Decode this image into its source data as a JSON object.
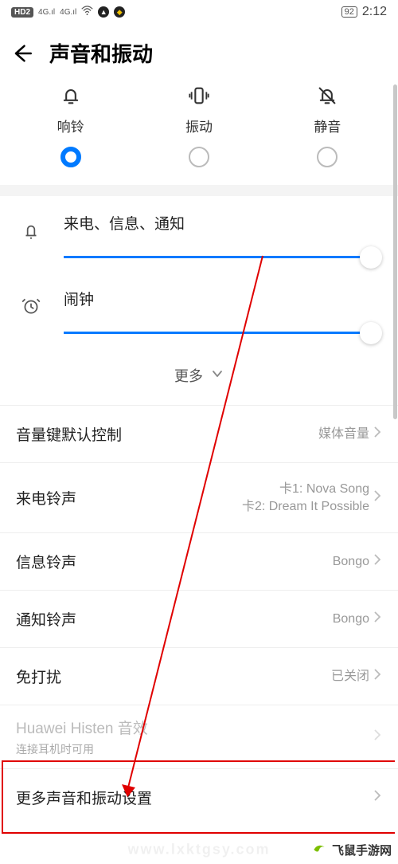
{
  "status": {
    "hd_badge": "HD2",
    "sig_a": "4G",
    "sig_b": "4G",
    "battery": "92",
    "clock": "2:12"
  },
  "header": {
    "title": "声音和振动"
  },
  "modes": [
    {
      "label": "响铃",
      "selected": true
    },
    {
      "label": "振动",
      "selected": false
    },
    {
      "label": "静音",
      "selected": false
    }
  ],
  "volumes": {
    "notify": {
      "label": "来电、信息、通知",
      "percent": 100
    },
    "alarm": {
      "label": "闹钟",
      "percent": 100
    }
  },
  "more_label": "更多",
  "settings": [
    {
      "label": "音量键默认控制",
      "value": "媒体音量"
    },
    {
      "label": "来电铃声",
      "value": "卡1: Nova Song\n卡2: Dream It Possible"
    },
    {
      "label": "信息铃声",
      "value": "Bongo"
    },
    {
      "label": "通知铃声",
      "value": "Bongo"
    },
    {
      "label": "免打扰",
      "value": "已关闭"
    },
    {
      "label": "Huawei Histen 音效",
      "sub": "连接耳机时可用",
      "disabled": true
    },
    {
      "label": "更多声音和振动设置"
    }
  ],
  "watermark": {
    "text": "飞鼠手游网",
    "faint": "www.lxktgsy.com"
  }
}
